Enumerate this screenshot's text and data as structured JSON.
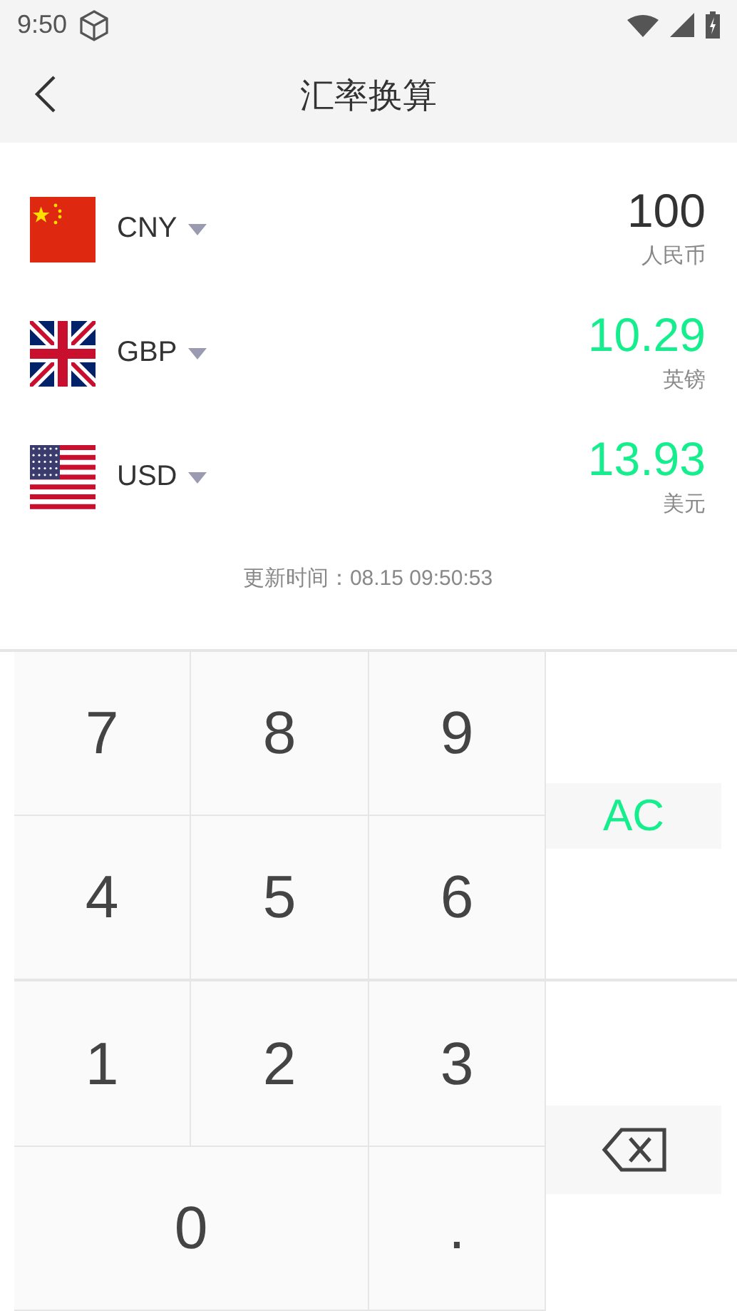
{
  "status_bar": {
    "time": "9:50"
  },
  "header": {
    "title": "汇率换算"
  },
  "currencies": [
    {
      "kind": "cn",
      "code": "CNY",
      "amount": "100",
      "name": "人民币",
      "input": true
    },
    {
      "kind": "gb",
      "code": "GBP",
      "amount": "10.29",
      "name": "英镑",
      "input": false
    },
    {
      "kind": "us",
      "code": "USD",
      "amount": "13.93",
      "name": "美元",
      "input": false
    }
  ],
  "update_time": "更新时间：08.15 09:50:53",
  "keypad": [
    {
      "kind": "digit",
      "label": "7"
    },
    {
      "kind": "digit",
      "label": "8"
    },
    {
      "kind": "digit",
      "label": "9"
    },
    {
      "kind": "clear",
      "label": "AC"
    },
    {
      "kind": "digit",
      "label": "4"
    },
    {
      "kind": "digit",
      "label": "5"
    },
    {
      "kind": "digit",
      "label": "6"
    },
    {
      "kind": "digit",
      "label": "1"
    },
    {
      "kind": "digit",
      "label": "2"
    },
    {
      "kind": "digit",
      "label": "3"
    },
    {
      "kind": "backspace"
    },
    {
      "kind": "digit",
      "label": "0"
    },
    {
      "kind": "digit",
      "label": "."
    }
  ]
}
